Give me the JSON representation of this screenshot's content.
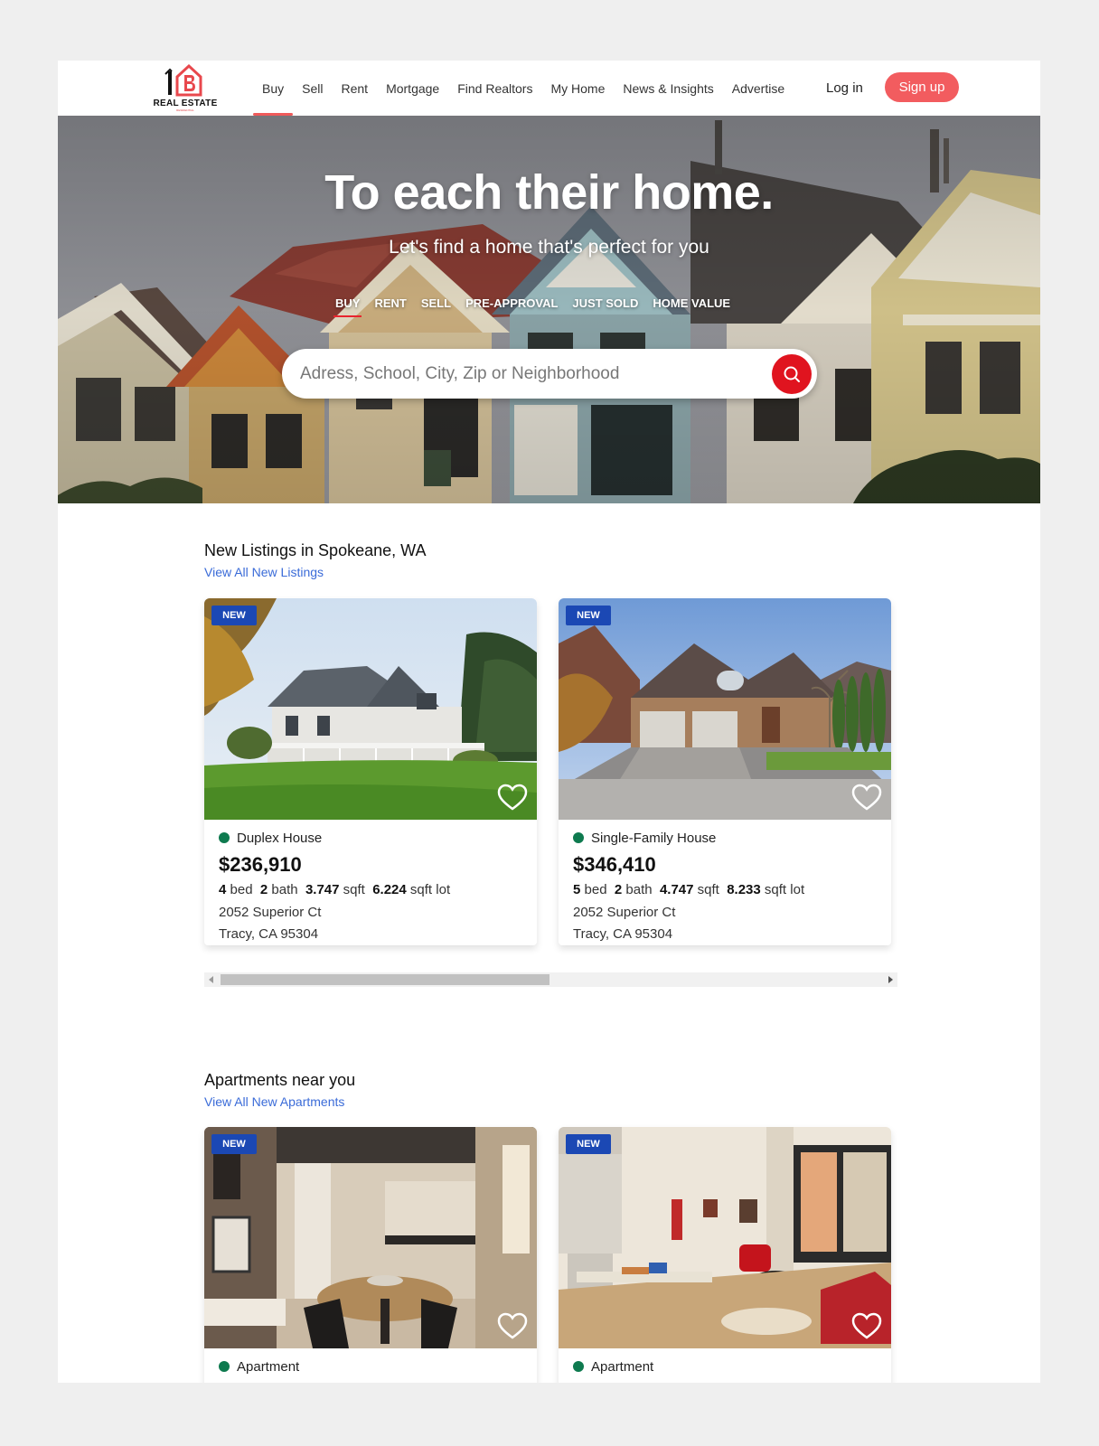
{
  "brand": {
    "logo_mark": "1B",
    "name": "REAL ESTATE",
    "tagline": "RESIDENTIAL",
    "accent": "#f25c5f"
  },
  "nav": {
    "items": [
      {
        "label": "Buy"
      },
      {
        "label": "Sell"
      },
      {
        "label": "Rent"
      },
      {
        "label": "Mortgage"
      },
      {
        "label": "Find Realtors"
      },
      {
        "label": "My Home"
      },
      {
        "label": "News & Insights"
      },
      {
        "label": "Advertise"
      }
    ],
    "active": "Buy",
    "login": "Log in",
    "signup": "Sign up"
  },
  "hero": {
    "title": "To each their home.",
    "subtitle": "Let's find a home that's perfect for you",
    "tabs": [
      {
        "label": "BUY"
      },
      {
        "label": "RENT"
      },
      {
        "label": "SELL"
      },
      {
        "label": "PRE-APPROVAL"
      },
      {
        "label": "JUST SOLD"
      },
      {
        "label": "HOME VALUE"
      }
    ],
    "active_tab": "BUY",
    "search_placeholder": "Adress, School, City, Zip or Neighborhood",
    "search_icon": "search-icon"
  },
  "new_listings": {
    "title": "New Listings in Spokeane, WA",
    "link": "View All New Listings",
    "cards": [
      {
        "badge": "NEW",
        "type": "Duplex House",
        "price": "$236,910",
        "beds": "4",
        "bed_label": "bed",
        "baths": "2",
        "bath_label": "bath",
        "sqft": "3.747",
        "sqft_label": "sqft",
        "lot": "6.224",
        "lot_label": "sqft lot",
        "street": "2052 Superior Ct",
        "city": "Tracy, CA 95304"
      },
      {
        "badge": "NEW",
        "type": "Single-Family House",
        "price": "$346,410",
        "beds": "5",
        "bed_label": "bed",
        "baths": "2",
        "bath_label": "bath",
        "sqft": "4.747",
        "sqft_label": "sqft",
        "lot": "8.233",
        "lot_label": "sqft lot",
        "street": "2052 Superior Ct",
        "city": "Tracy, CA 95304"
      }
    ],
    "scroll_position": 0.46
  },
  "apartments": {
    "title": "Apartments near you",
    "link": "View All New Apartments",
    "cards": [
      {
        "badge": "NEW",
        "type": "Apartment"
      },
      {
        "badge": "NEW",
        "type": "Apartment"
      }
    ]
  },
  "colors": {
    "badge": "#1b48b4",
    "status_dot": "#0e7a4f",
    "link": "#3a6bd8",
    "search_button": "#e0141f"
  }
}
